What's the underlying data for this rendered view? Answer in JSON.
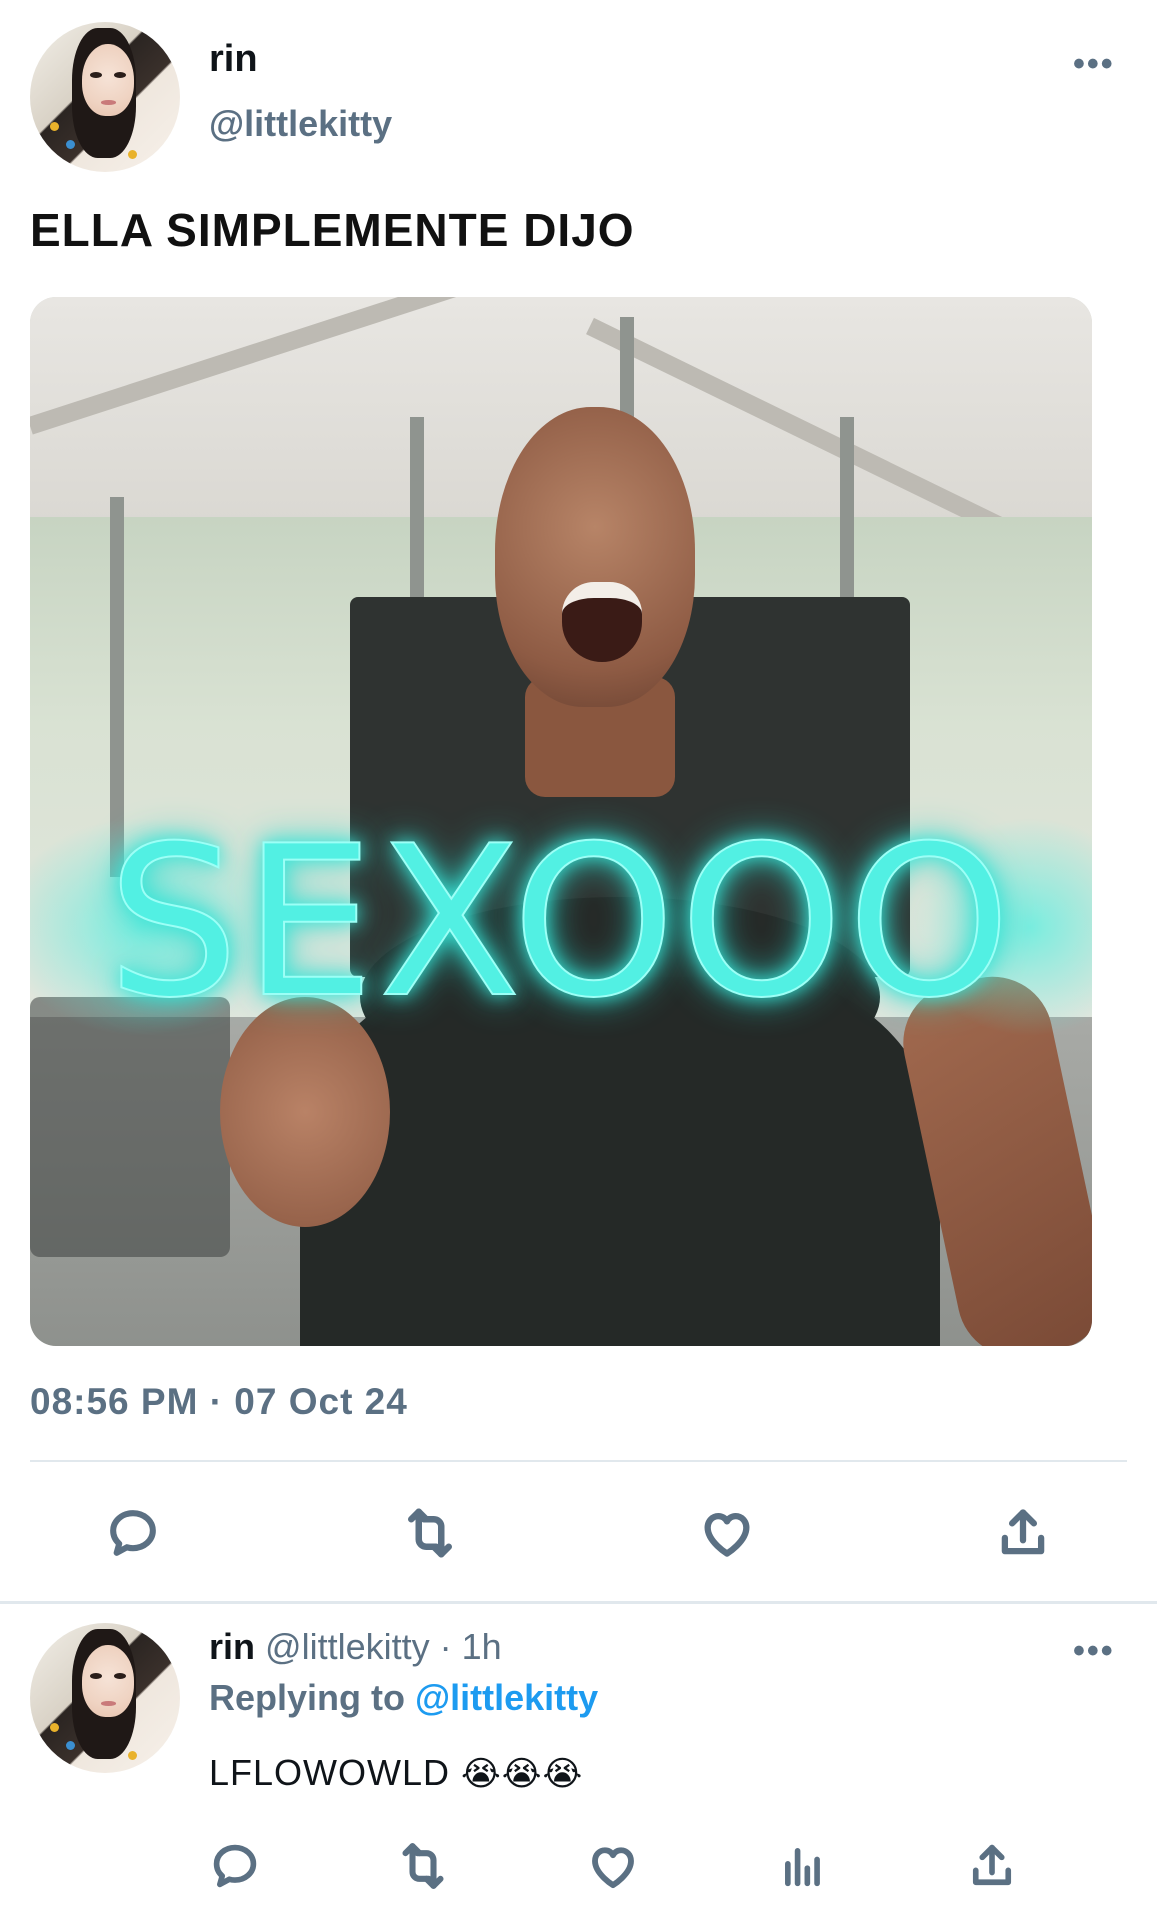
{
  "tweet": {
    "author_name": "rin",
    "author_handle": "@littlekitty",
    "more_label": "•••",
    "text": "ELLA SIMPLEMENTE DIJO",
    "media": {
      "overlay_text": "SEXOOO"
    },
    "timestamp": "08:56 PM · 07 Oct 24",
    "actions": [
      {
        "name": "reply",
        "icon": "reply-icon"
      },
      {
        "name": "retweet",
        "icon": "retweet-icon"
      },
      {
        "name": "like",
        "icon": "heart-icon"
      },
      {
        "name": "share",
        "icon": "share-icon"
      }
    ]
  },
  "reply": {
    "author_name": "rin",
    "author_handle": "@littlekitty",
    "separator": "·",
    "time": "1h",
    "replying_prefix": "Replying to ",
    "replying_to": "@littlekitty",
    "text": "LFLOWOWLD",
    "emojis": "😭😭😭",
    "more_label": "•••",
    "actions": [
      {
        "name": "reply",
        "icon": "reply-icon"
      },
      {
        "name": "retweet",
        "icon": "retweet-icon"
      },
      {
        "name": "like",
        "icon": "heart-icon"
      },
      {
        "name": "analytics",
        "icon": "analytics-icon"
      },
      {
        "name": "share",
        "icon": "share-icon"
      }
    ]
  },
  "colors": {
    "primary_text": "#0f1419",
    "secondary_text": "#5b7083",
    "link": "#1d9bf0",
    "divider": "#e1e8ed",
    "overlay_text": "#52f0e3"
  }
}
